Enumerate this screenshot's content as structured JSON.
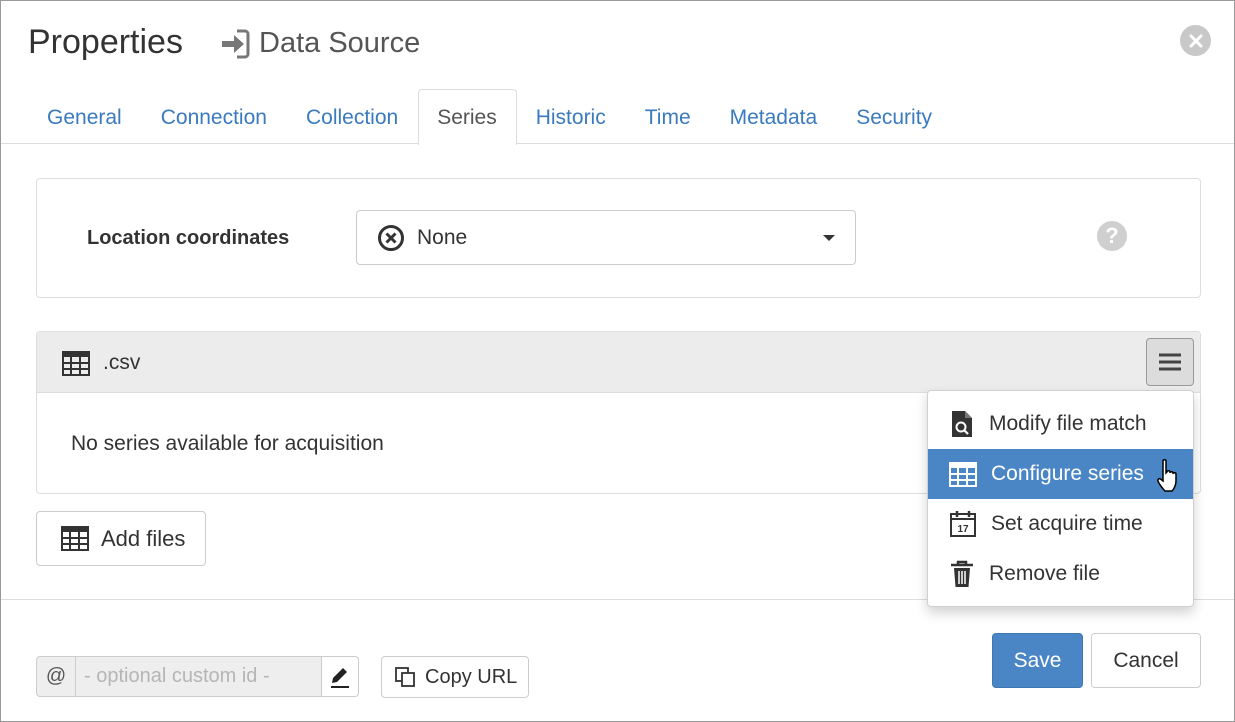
{
  "dialog": {
    "title": "Properties",
    "subtitle": "Data Source"
  },
  "tabs": [
    {
      "label": "General",
      "active": false
    },
    {
      "label": "Connection",
      "active": false
    },
    {
      "label": "Collection",
      "active": false
    },
    {
      "label": "Series",
      "active": true
    },
    {
      "label": "Historic",
      "active": false
    },
    {
      "label": "Time",
      "active": false
    },
    {
      "label": "Metadata",
      "active": false
    },
    {
      "label": "Security",
      "active": false
    }
  ],
  "location": {
    "label": "Location coordinates",
    "selected": "None",
    "help": "?"
  },
  "file_panel": {
    "file_name": ".csv",
    "empty_message": "No series available for acquisition"
  },
  "dropdown": {
    "items": [
      {
        "label": "Modify file match",
        "icon": "file-search-icon"
      },
      {
        "label": "Configure series",
        "icon": "table-icon",
        "active": true
      },
      {
        "label": "Set acquire time",
        "icon": "calendar-icon"
      },
      {
        "label": "Remove file",
        "icon": "trash-icon"
      }
    ]
  },
  "add_files": {
    "label": "Add files"
  },
  "footer": {
    "at_symbol": "@",
    "custom_id_placeholder": "- optional custom id -",
    "copy_url_label": "Copy URL",
    "save_label": "Save",
    "cancel_label": "Cancel"
  },
  "colors": {
    "accent": "#4a86c5",
    "link": "#3a7abf"
  }
}
